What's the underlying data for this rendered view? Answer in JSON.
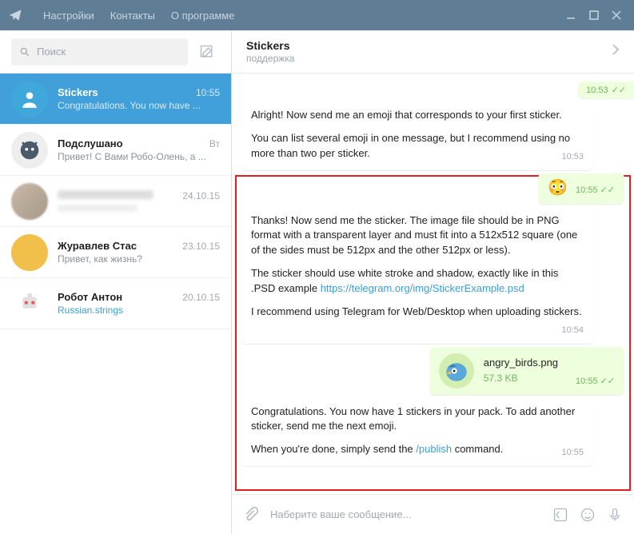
{
  "titlebar": {
    "menu": [
      "Настройки",
      "Контакты",
      "О программе"
    ]
  },
  "search": {
    "placeholder": "Поиск"
  },
  "chats": [
    {
      "name": "Stickers",
      "time": "10:55",
      "preview": "Congratulations. You now have ...",
      "active": true,
      "avatarColor": "#3fa7d9"
    },
    {
      "name": "Подслушано",
      "time": "Вт",
      "preview": "Привет! С Вами Робо-Олень, а ...",
      "avatarColor": "#f2f2f2"
    },
    {
      "name": "",
      "time": "24.10.15",
      "preview": "",
      "blurred": true
    },
    {
      "name": "Журавлев Стас",
      "time": "23.10.15",
      "preview": "Привет, как жизнь?",
      "avatarColor": "#f2c04a"
    },
    {
      "name": "Робот Антон",
      "time": "20.10.15",
      "preview": "Russian.strings",
      "previewLink": true,
      "avatarColor": "#e85a5a"
    }
  ],
  "header": {
    "title": "Stickers",
    "subtitle": "поддержка"
  },
  "messages": {
    "cut": {
      "time": "10:53"
    },
    "m1": {
      "p1": "Alright! Now send me an emoji that corresponds to your first sticker.",
      "p2": "You can list several emoji in one message, but I recommend using no more than two per sticker.",
      "time": "10:53"
    },
    "m2": {
      "emoji": "😳",
      "time": "10:55"
    },
    "m3": {
      "p1": "Thanks! Now send me the sticker. The image file should be in PNG format with a transparent layer and must fit into a 512x512 square (one of the sides must be 512px and the other 512px or less).",
      "p2a": "The sticker should use white stroke and shadow, exactly like in this .PSD example ",
      "p2link": "https://telegram.org/img/StickerExample.psd",
      "p3": "I recommend using Telegram for Web/Desktop when uploading stickers.",
      "time": "10:54"
    },
    "m4": {
      "filename": "angry_birds.png",
      "filesize": "57.3 KB",
      "time": "10:55"
    },
    "m5": {
      "p1": "Congratulations. You now have 1 stickers in your pack. To add another sticker, send me the next emoji.",
      "p2a": "When you're done, simply send the ",
      "p2link": "/publish",
      "p2b": " command.",
      "time": "10:55"
    }
  },
  "input": {
    "placeholder": "Наберите ваше сообщение..."
  }
}
